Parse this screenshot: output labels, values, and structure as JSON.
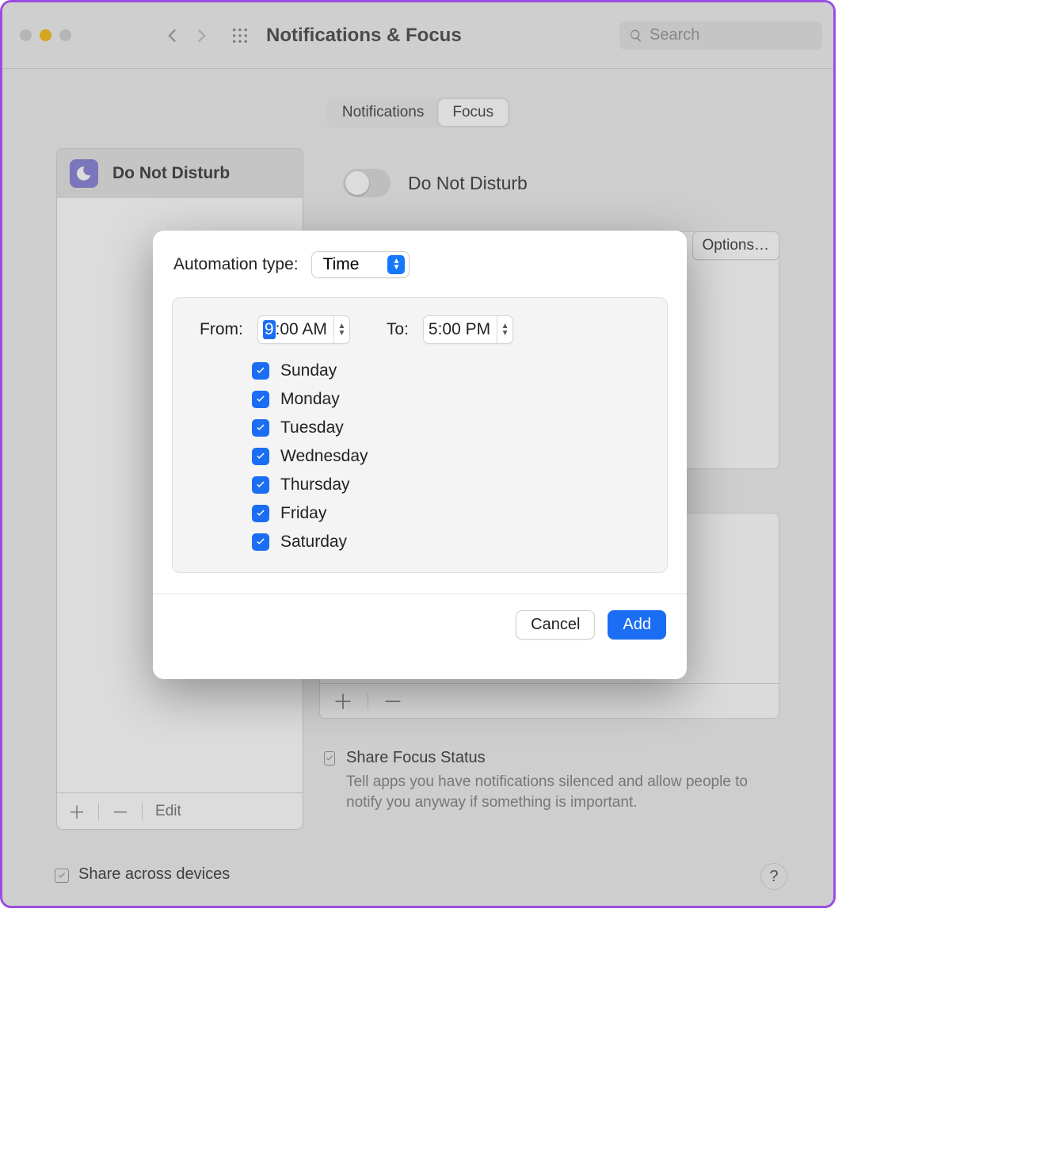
{
  "window": {
    "title": "Notifications & Focus",
    "search_placeholder": "Search"
  },
  "tabs": {
    "notifications": "Notifications",
    "focus": "Focus"
  },
  "sidebar": {
    "item_label": "Do Not Disturb",
    "edit_label": "Edit"
  },
  "main": {
    "dnd_label": "Do Not Disturb",
    "dnd_on": false,
    "options_label": "Options…",
    "share_focus_title": "Share Focus Status",
    "share_focus_sub": "Tell apps you have notifications silenced and allow people to notify you anyway if something is important."
  },
  "footer": {
    "share_across": "Share across devices"
  },
  "dialog": {
    "automation_label": "Automation type:",
    "automation_value": "Time",
    "from_label": "From:",
    "to_label": "To:",
    "from_hour_selected": "9",
    "from_rest": ":00 AM",
    "to_value": "5:00 PM",
    "days": [
      {
        "label": "Sunday",
        "checked": true
      },
      {
        "label": "Monday",
        "checked": true
      },
      {
        "label": "Tuesday",
        "checked": true
      },
      {
        "label": "Wednesday",
        "checked": true
      },
      {
        "label": "Thursday",
        "checked": true
      },
      {
        "label": "Friday",
        "checked": true
      },
      {
        "label": "Saturday",
        "checked": true
      }
    ],
    "cancel": "Cancel",
    "add": "Add"
  }
}
